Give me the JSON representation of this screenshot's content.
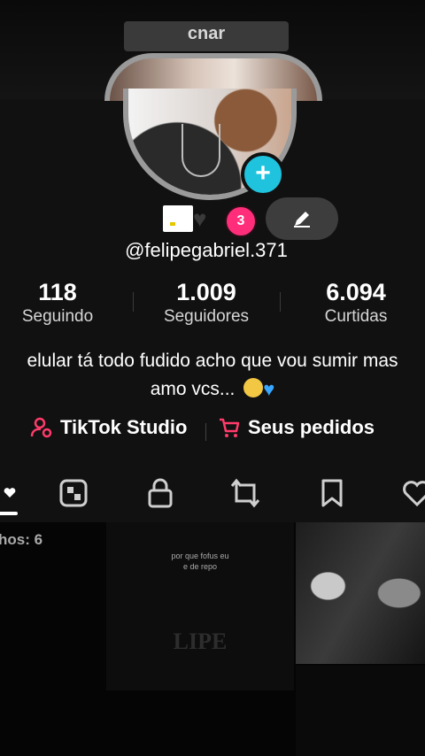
{
  "header": {
    "title_partial": "cnar"
  },
  "profile": {
    "username": "@felipegabriel.371",
    "badge_count": "3"
  },
  "stats": [
    {
      "value": "118",
      "label": "Seguindo"
    },
    {
      "value": "1.009",
      "label": "Seguidores"
    },
    {
      "value": "6.094",
      "label": "Curtidas"
    }
  ],
  "bio": {
    "line1": "elular tá todo fudido acho que vou sumir mas",
    "line2": "amo vcs..."
  },
  "links": {
    "studio": "TikTok Studio",
    "orders": "Seus pedidos",
    "accent_color": "#ff3b6b"
  },
  "tabs": [
    "videos",
    "reposts-grid",
    "private",
    "repost",
    "saved",
    "liked"
  ],
  "grid": {
    "partial_label": "hos: 6",
    "tile_caption": "por que fofus eu\ne de repo",
    "tile_watermark": "LIPE"
  }
}
